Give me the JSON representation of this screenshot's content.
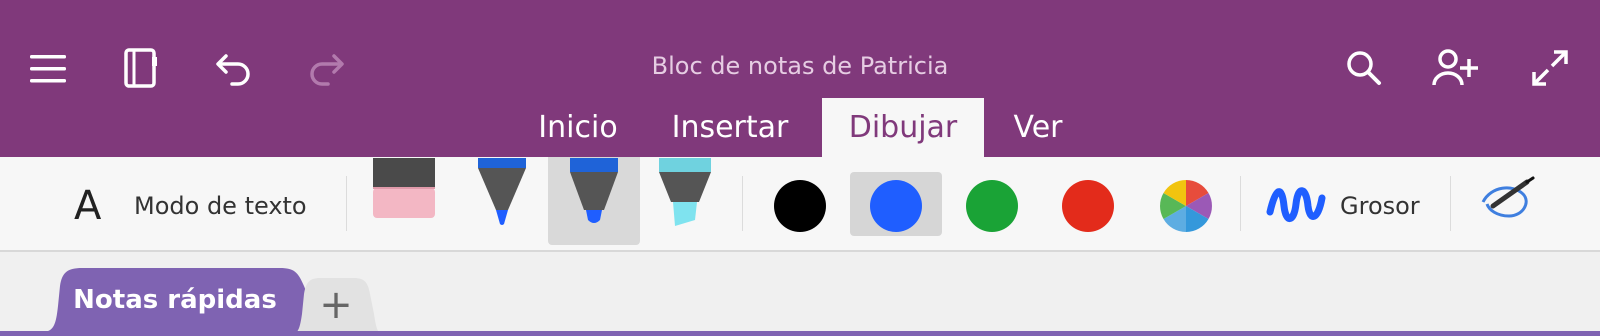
{
  "header": {
    "title": "Bloc de notas de Patricia",
    "icons": [
      "hamburger-icon",
      "notebook-icon",
      "undo-icon",
      "redo-icon",
      "search-icon",
      "add-person-icon",
      "expand-icon"
    ]
  },
  "ribbon": {
    "tabs": [
      {
        "label": "Inicio"
      },
      {
        "label": "Insertar"
      },
      {
        "label": "Dibujar"
      },
      {
        "label": "Ver"
      }
    ],
    "active_tab": "Dibujar"
  },
  "draw_toolbar": {
    "text_mode_glyph": "A",
    "text_mode_label": "Modo de texto",
    "thickness_label": "Grosor",
    "tools": [
      "eraser",
      "pen",
      "marker",
      "highlighter"
    ],
    "colors": [
      "#000000",
      "#1f5eff",
      "#1aa336",
      "#e32b1b"
    ]
  },
  "sections": {
    "active_label": "Notas rápidas",
    "add_glyph": "+"
  },
  "colors": {
    "brand": "#80397b",
    "section_tab": "#7f63b2",
    "toolbar_bg": "#f7f7f7"
  }
}
